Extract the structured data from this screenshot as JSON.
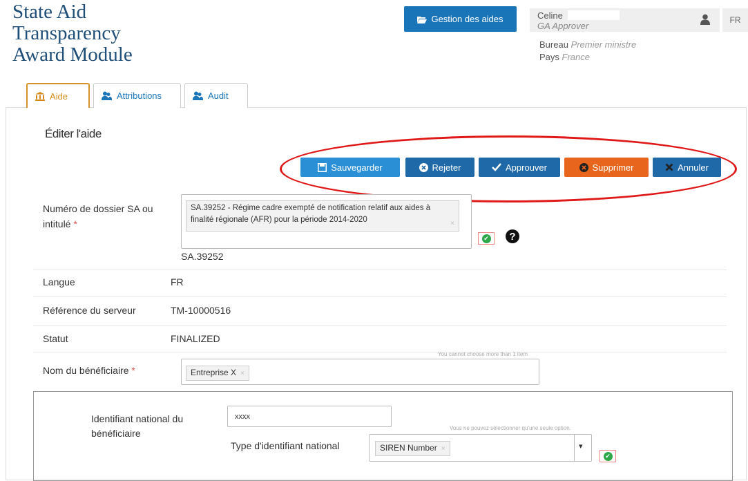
{
  "header": {
    "title": "State Aid\nTransparency\nAward Module",
    "gestion_label": "Gestion des aides",
    "user_name": "Celine",
    "user_role": "GA Approver",
    "lang": "FR",
    "bureau_label": "Bureau",
    "bureau_value": "Premier ministre",
    "pays_label": "Pays",
    "pays_value": "France"
  },
  "tabs": [
    {
      "label": "Aide",
      "icon": "bank-icon",
      "active": true
    },
    {
      "label": "Attributions",
      "icon": "users-icon",
      "active": false
    },
    {
      "label": "Audit",
      "icon": "users-icon",
      "active": false
    }
  ],
  "panel": {
    "title": "Éditer l'aide",
    "actions": {
      "save": "Sauvegarder",
      "reject": "Rejeter",
      "approve": "Approuver",
      "delete": "Supprimer",
      "cancel": "Annuler"
    }
  },
  "form": {
    "dossier": {
      "label": "Numéro de dossier SA ou intitulé",
      "required": "*",
      "chip": "SA.39252 - Régime cadre exempté de notification relatif aux aides à finalité régionale (AFR) pour la période 2014-2020",
      "chip_x": "×",
      "below": "SA.39252",
      "help": "?"
    },
    "langue": {
      "label": "Langue",
      "value": "FR"
    },
    "reference": {
      "label": "Référence du serveur",
      "value": "TM-10000516"
    },
    "statut": {
      "label": "Statut",
      "value": "FINALIZED"
    },
    "beneficiaire": {
      "label": "Nom du bénéficiaire",
      "required": "*",
      "hint": "You cannot choose more than 1 item",
      "chip": "Entreprise X",
      "chip_x": "×"
    },
    "identifiant": {
      "label": "Identifiant national du bénéficiaire",
      "value": "xxxx",
      "hint": "Vous ne pouvez sélectionner qu'une seule option."
    },
    "type_identifiant": {
      "label": "Type d'identifiant national",
      "chip": "SIREN Number",
      "chip_x": "×",
      "caret": "▾"
    }
  }
}
